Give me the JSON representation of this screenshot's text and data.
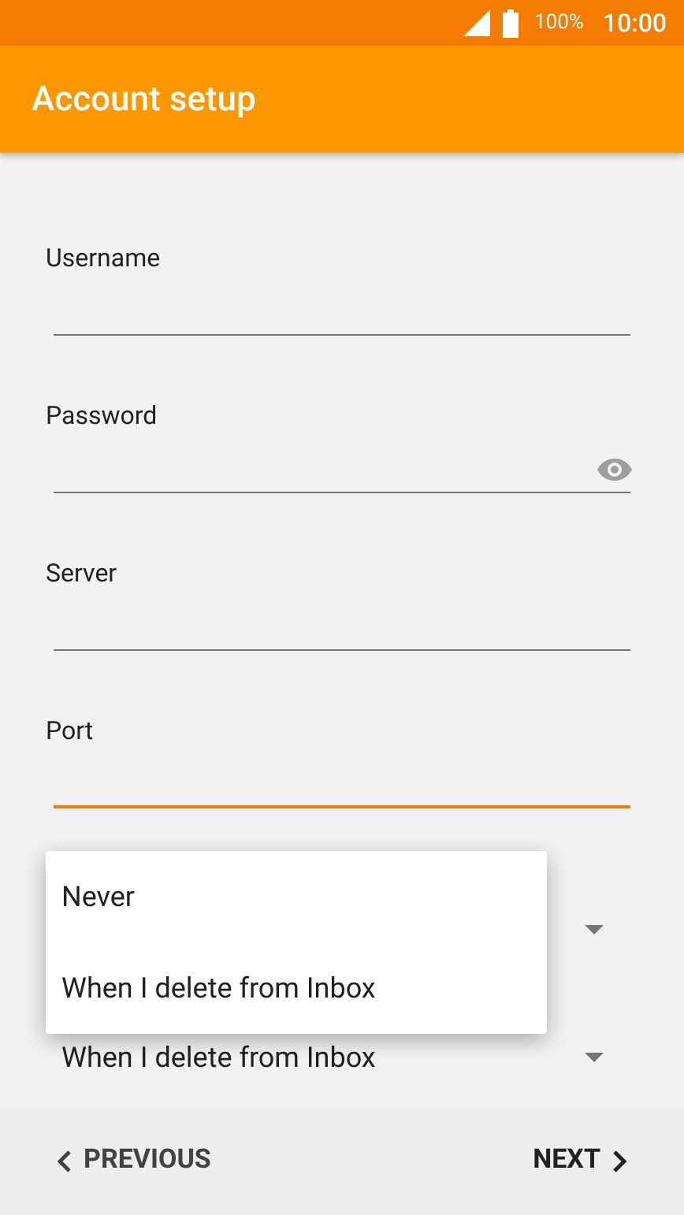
{
  "status_bar": {
    "battery": "100%",
    "time": "10:00"
  },
  "app_bar": {
    "title": "Account setup"
  },
  "fields": [
    {
      "label": "Username",
      "kind": "text",
      "focused": false
    },
    {
      "label": "Password",
      "kind": "password",
      "focused": false
    },
    {
      "label": "Server",
      "kind": "text",
      "focused": false
    },
    {
      "label": "Port",
      "kind": "text",
      "focused": true
    }
  ],
  "dropdowns": [
    {
      "kind": "covered"
    },
    {
      "kind": "select",
      "value": "When I delete from Inbox"
    }
  ],
  "menu": {
    "options": [
      "Never",
      "When I delete from Inbox"
    ]
  },
  "bottom_bar": {
    "previous": "PREVIOUS",
    "next": "NEXT"
  }
}
